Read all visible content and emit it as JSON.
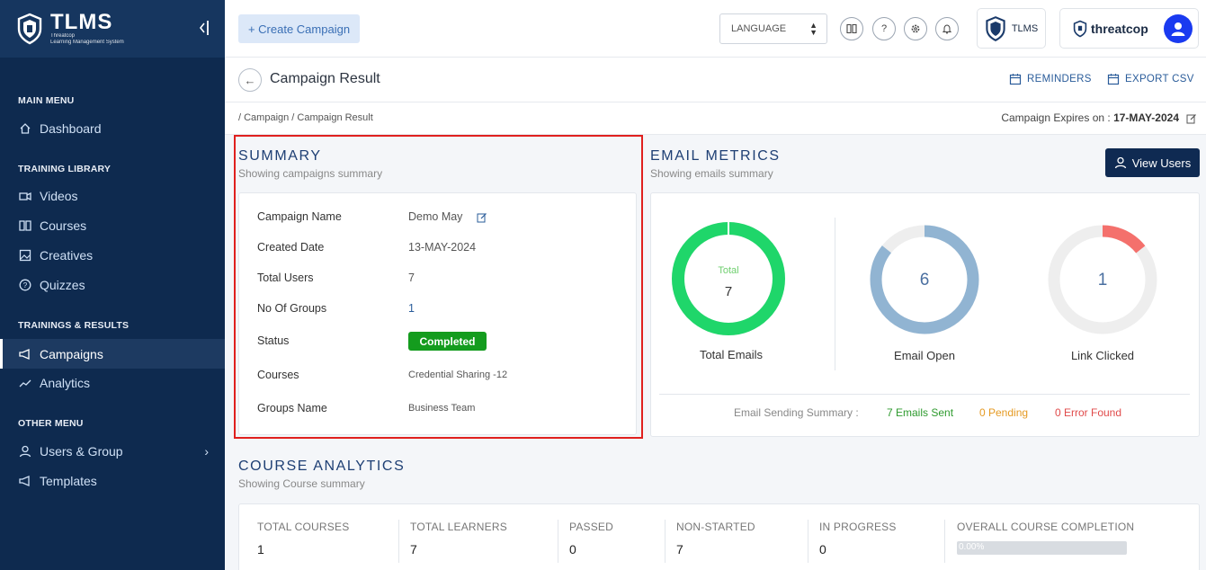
{
  "sidebar": {
    "brand_title": "TLMS",
    "brand_sub_1": "Threatcop",
    "brand_sub_2": "Learning Management System",
    "collapse_icon": "collapse-icon",
    "sections": {
      "main_menu": "MAIN MENU",
      "training_library": "TRAINING LIBRARY",
      "trainings_results": "TRAININGS & RESULTS",
      "other_menu": "OTHER MENU"
    },
    "items": [
      {
        "label": "Dashboard",
        "icon": "home-icon"
      },
      {
        "label": "Videos",
        "icon": "video-icon"
      },
      {
        "label": "Courses",
        "icon": "book-icon"
      },
      {
        "label": "Creatives",
        "icon": "image-icon"
      },
      {
        "label": "Quizzes",
        "icon": "question-icon"
      },
      {
        "label": "Campaigns",
        "icon": "megaphone-icon"
      },
      {
        "label": "Analytics",
        "icon": "trend-icon"
      },
      {
        "label": "Users & Group",
        "icon": "user-icon"
      },
      {
        "label": "Templates",
        "icon": "megaphone-icon"
      }
    ]
  },
  "topbar": {
    "create_campaign": "+ Create Campaign",
    "language": "LANGUAGE",
    "tlms_label": "TLMS",
    "threatcop_label": "threatcop"
  },
  "header": {
    "title": "Campaign Result",
    "reminders": "REMINDERS",
    "export_csv": "EXPORT CSV"
  },
  "breadcrumb": {
    "path": "/ Campaign / Campaign Result",
    "expires_label": "Campaign Expires on :",
    "expires_value": "17-MAY-2024"
  },
  "summary": {
    "title": "SUMMARY",
    "subtitle": "Showing campaigns summary",
    "rows": {
      "campaign_name": {
        "label": "Campaign Name",
        "value": "Demo May"
      },
      "created_date": {
        "label": "Created Date",
        "value": "13-MAY-2024"
      },
      "total_users": {
        "label": "Total Users",
        "value": "7"
      },
      "no_of_groups": {
        "label": "No Of Groups",
        "value": "1"
      },
      "status": {
        "label": "Status",
        "value": "Completed"
      },
      "courses": {
        "label": "Courses",
        "value": "Credential Sharing -12"
      },
      "groups_name": {
        "label": "Groups Name",
        "value": "Business Team"
      }
    }
  },
  "email_metrics": {
    "title": "EMAIL METRICS",
    "subtitle": "Showing emails summary",
    "view_users": "View Users",
    "donuts": {
      "total": {
        "caption": "Total",
        "value": "7",
        "label": "Total Emails",
        "fraction": 1.0,
        "color": "#1fd66a"
      },
      "open": {
        "value": "6",
        "label": "Email Open",
        "fraction": 0.857,
        "color": "#91b4d2"
      },
      "clicked": {
        "value": "1",
        "label": "Link Clicked",
        "fraction": 0.143,
        "color": "#f4706c"
      }
    },
    "sending_summary": {
      "label": "Email Sending Summary :",
      "sent": "7 Emails Sent",
      "pending": "0 Pending",
      "error": "0 Error Found"
    }
  },
  "course_analytics": {
    "title": "COURSE ANALYTICS",
    "subtitle": "Showing Course summary",
    "columns": [
      {
        "header": "TOTAL COURSES",
        "value": "1"
      },
      {
        "header": "TOTAL LEARNERS",
        "value": "7"
      },
      {
        "header": "PASSED",
        "value": "0"
      },
      {
        "header": "NON-STARTED",
        "value": "7"
      },
      {
        "header": "IN PROGRESS",
        "value": "0"
      },
      {
        "header": "OVERALL COURSE COMPLETION",
        "value": "0.00%"
      }
    ],
    "completion_fraction": 0.0
  }
}
